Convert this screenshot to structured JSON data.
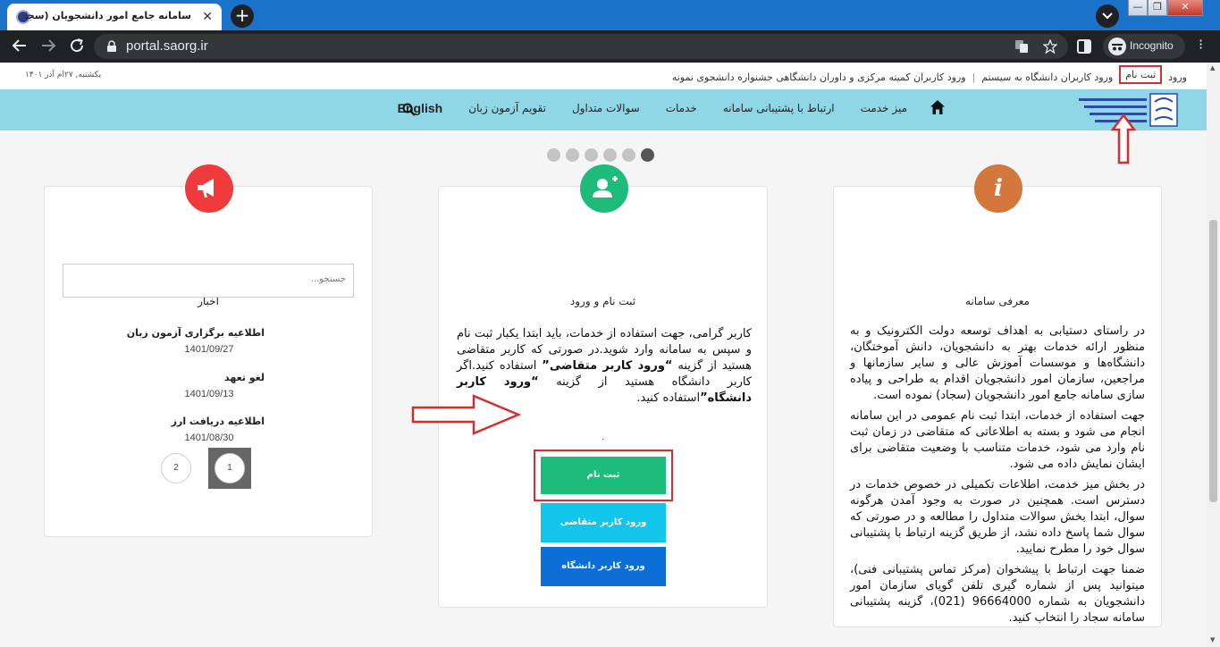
{
  "browser": {
    "tab_title": "سامانه جامع امور دانشجویان (سجاد) – سامانه",
    "tab_close": "✕",
    "new_tab": "+",
    "url": "portal.saorg.ir",
    "incognito_label": "Incognito",
    "window_buttons": {
      "minimize": "—",
      "maximize": "❐",
      "close": "✕"
    }
  },
  "topbar": {
    "login": "ورود",
    "register": "ثبت نام",
    "uni_login": "ورود کاربران دانشگاه به سیستم",
    "committee_login": "ورود کاربران کمیته مرکزی و داوران دانشگاهی جشنواره دانشجوی نمونه",
    "date": "یکشنبه, ۲۷ام آذر ۱۴۰۱"
  },
  "navbar": {
    "logo_text": "جمهوری اسلامی ایران وزارت علوم، تحقیقات و فناوری سازمان امور دانشجویان",
    "items": [
      "میز خدمت",
      "ارتباط با پشتیبانی سامانه",
      "خدمات",
      "سوالات متداول",
      "تقویم آزمون زبان"
    ],
    "english": "English"
  },
  "cards": {
    "about": {
      "title": "معرفی سامانه",
      "icon": "info-icon",
      "paragraphs": [
        "در راستای دستیابی به اهداف توسعه دولت الکترونیک و به منظور ارائه خدمات بهتر به دانشجویان، دانش آموختگان، دانشگاه‌ها و موسسات آموزش عالی و سایر سازمانها و مراجعین، سازمان امور دانشجویان اقدام به طراحی و پیاده سازی سامانه جامع امور دانشجویان (سجاد) نموده است.",
        "جهت استفاده از خدمات، ابتدا ثبت نام عمومی در این سامانه انجام می شود و بسته به اطلاعاتی که متقاضی در زمان ثبت نام وارد می شود، خدمات متناسب با وضعیت متقاضی برای ایشان نمایش داده می شود.",
        "در بخش میز خدمت، اطلاعات تکمیلی در خصوص خدمات در دسترس است. همچنین در صورت به وجود آمدن هرگونه سوال، ابتدا بخش سوالات متداول را مطالعه و در صورتی که سوال شما پاسخ داده نشد، از طریق گزینه ارتباط با پشتیبانی سوال خود را مطرح نمایید.",
        "ضمنا جهت ارتباط با پیشخوان (مرکز تماس پشتیبانی فنی)، میتوانید پس از شماره گیری تلفن گویای سازمان امور دانشجویان به شماره 96664000 (021)، گزینه پشتیبانی سامانه سجاد را انتخاب کنید."
      ]
    },
    "register": {
      "title": "ثبت نام و ورود",
      "icon": "add-user-icon",
      "text_1": "کاربر گرامی، جهت استفاده از خدمات، باید ابتدا یکبار ثبت نام و سپس به سامانه وارد شوید.در صورتی که کاربر متقاضی هستید از گزینه ",
      "bold_1": "“ورود کاربر متقاضی”",
      "text_2": " استفاده کنید.اگر کاربر دانشگاه هستید از گزینه ",
      "bold_2": "“ورود کاربر دانشگاه”",
      "text_3": "استفاده کنید.",
      "dot": ".",
      "signup_button": "ثبت نام",
      "applicant_button": "ورود کاربر متقاضی",
      "university_button": "ورود کاربر دانشگاه"
    },
    "news": {
      "title": "اخبار",
      "icon": "megaphone-icon",
      "search_placeholder": "جستجو...",
      "items": [
        {
          "title": "اطلاعیه برگزاری آزمون زبان",
          "date": "1401/09/27"
        },
        {
          "title": "لغو تعهد",
          "date": "1401/09/13"
        },
        {
          "title": "اطلاعیه دریافت ارز",
          "date": "1401/08/30"
        }
      ],
      "pages": [
        "1",
        "2"
      ]
    }
  },
  "colors": {
    "navbar": "#8fd7e6",
    "about_icon": "#d4773c",
    "register_icon": "#1ebc7a",
    "news_icon": "#ef3b3b",
    "signup_button": "#1ebc7a",
    "applicant_button": "#12c5ea",
    "university_button": "#0b6fd7",
    "annotation_red": "#d32f2f"
  }
}
